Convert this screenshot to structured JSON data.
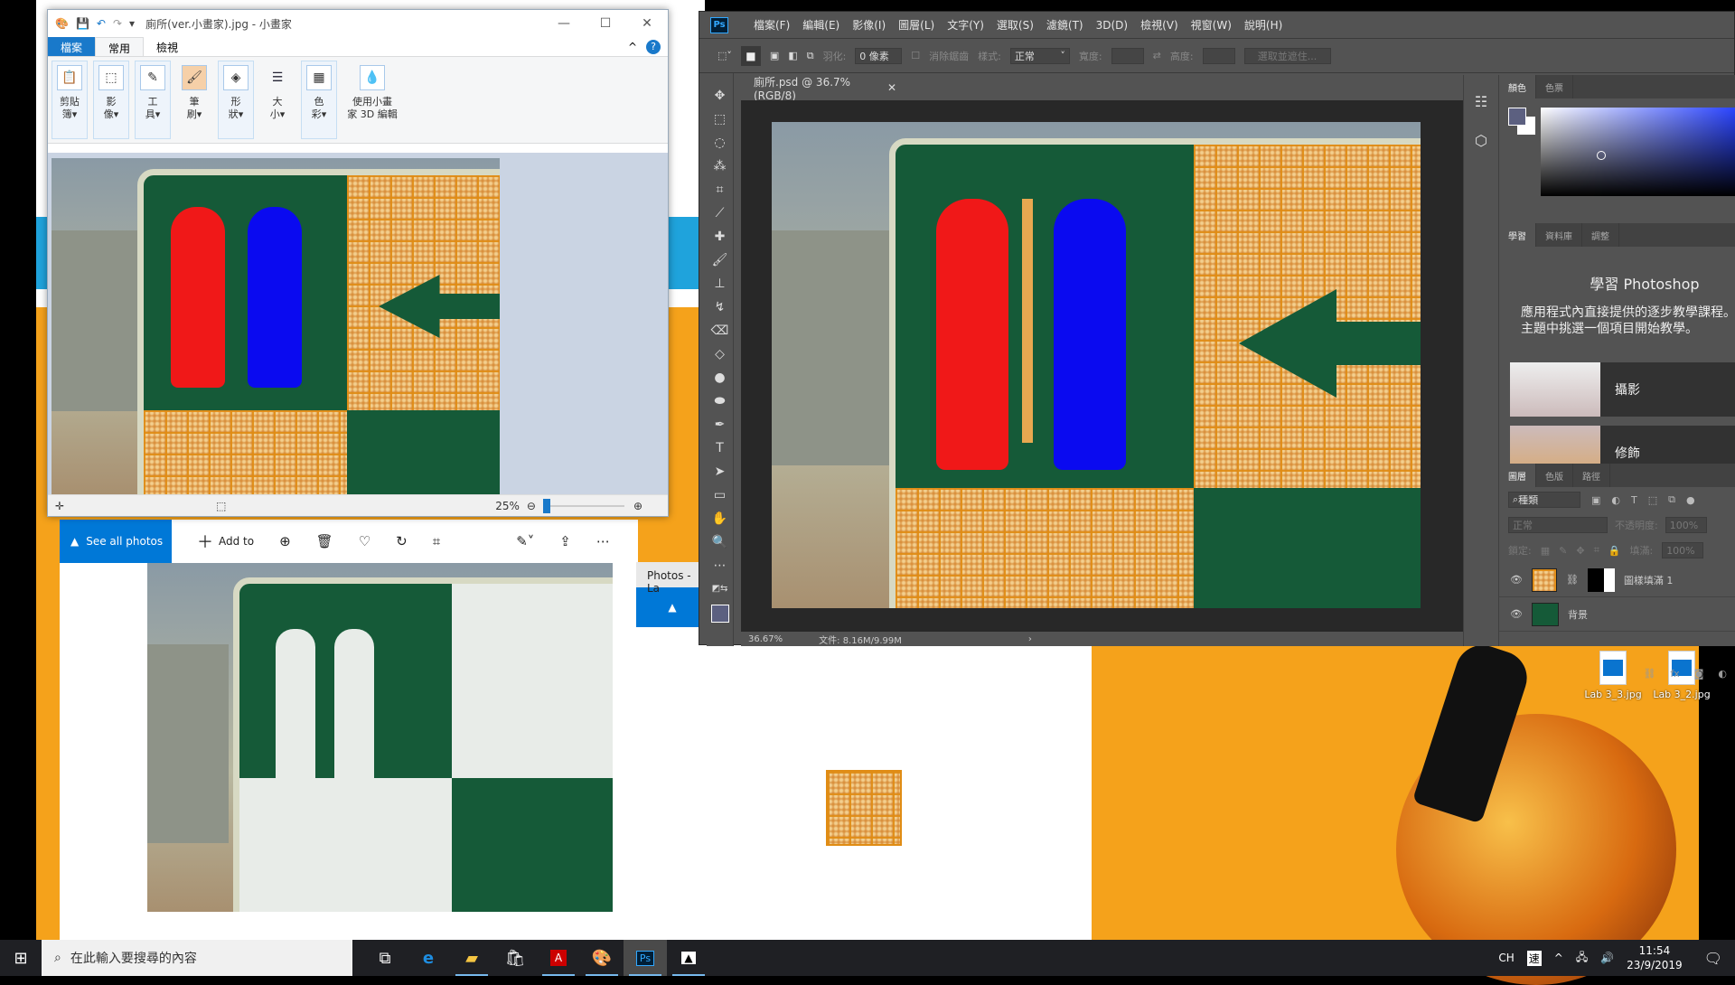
{
  "paint": {
    "title": "廁所(ver.小畫家).jpg - 小畫家",
    "tabs": [
      "檔案",
      "常用",
      "檢視"
    ],
    "ribbon": [
      {
        "label": "剪貼\n簿▾",
        "icon": "clipboard-icon"
      },
      {
        "label": "影\n像▾",
        "icon": "select-icon"
      },
      {
        "label": "工\n具▾",
        "icon": "tools-icon"
      },
      {
        "label": "筆\n刷▾",
        "icon": "brush-icon"
      },
      {
        "label": "形\n狀▾",
        "icon": "shapes-icon"
      },
      {
        "label": "大\n小▾",
        "icon": "size-icon"
      },
      {
        "label": "色\n彩▾",
        "icon": "colors-icon"
      },
      {
        "label": "使用小畫\n家 3D 編輯",
        "icon": "paint3d-icon"
      }
    ],
    "zoom": "25%",
    "zoom_value": 0.25
  },
  "photoshop": {
    "menu": [
      "檔案(F)",
      "編輯(E)",
      "影像(I)",
      "圖層(L)",
      "文字(Y)",
      "選取(S)",
      "濾鏡(T)",
      "3D(D)",
      "檢視(V)",
      "視窗(W)",
      "說明(H)"
    ],
    "options": {
      "feather_label": "羽化:",
      "feather_value": "0 像素",
      "antialias_label": "消除鋸齒",
      "style_label": "樣式:",
      "style_value": "正常",
      "width_label": "寬度:",
      "height_label": "高度:",
      "select_mask_label": "選取並遮住..."
    },
    "doc_tab": "廁所.psd @ 36.7% (RGB/8)",
    "status_zoom": "36.67%",
    "status_doc": "文件: 8.16M/9.99M",
    "color_tabs": [
      "顏色",
      "色票"
    ],
    "learn_tabs": [
      "學習",
      "資料庫",
      "調整"
    ],
    "learn_title": "學習 Photoshop",
    "learn_desc": "應用程式內直接提供的逐步教學課程。從以下主題中挑選一個項目開始教學。",
    "learn_items": [
      "攝影",
      "修飾"
    ],
    "layer_tabs": [
      "圖層",
      "色版",
      "路徑"
    ],
    "layer_filter": "種類",
    "blend_mode": "正常",
    "opacity_label": "不透明度:",
    "opacity": "100%",
    "lock_label": "鎖定:",
    "fill_label": "填滿:",
    "fill": "100%",
    "layers": [
      {
        "name": "圖樣填滿 1",
        "visible": true
      },
      {
        "name": "背景",
        "visible": true
      }
    ],
    "colors": {
      "foreground": "#5c6080",
      "background": "#ffffff"
    }
  },
  "photos": {
    "see_all": "See all photos",
    "add_to": "Add to",
    "second_title": "Photos - La"
  },
  "desktop": {
    "icons": [
      "Lab 3_3.jpg",
      "Lab 3_2.jpg"
    ]
  },
  "taskbar": {
    "search_placeholder": "在此輸入要搜尋的內容",
    "ime": "CH",
    "ime_mode": "速",
    "time": "11:54",
    "date": "23/9/2019"
  }
}
